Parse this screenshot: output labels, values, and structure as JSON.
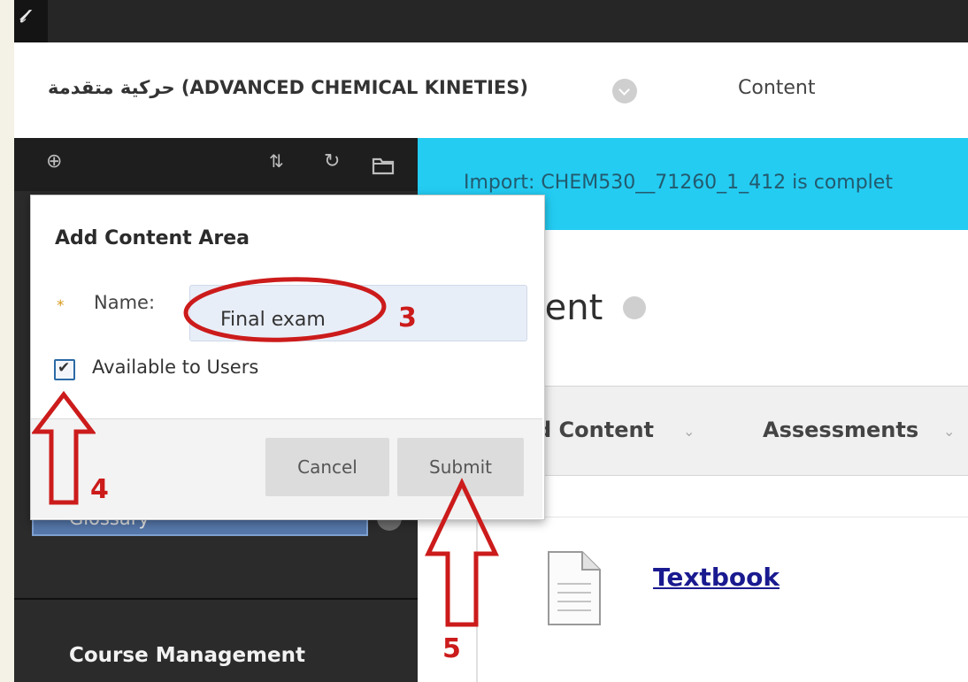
{
  "topbar": {
    "icon": "link-icon"
  },
  "course": {
    "title": "حركية متقدمة (ADVANCED CHEMICAL KINETIES)",
    "breadcrumb": "Content"
  },
  "sidebar": {
    "toolbar_icons": [
      "add-icon",
      "sort-icon",
      "refresh-icon",
      "folder-icon"
    ],
    "glossary_label": "Glossary",
    "course_management": "Course Management"
  },
  "main": {
    "receipt": "Import: CHEM530__71260_1_412 is complet",
    "page_title": "tent",
    "actions": {
      "build_content": "d Content",
      "assessments": "Assessments"
    },
    "items": [
      {
        "title": "Textbook",
        "icon": "document-icon"
      }
    ]
  },
  "dialog": {
    "title": "Add Content Area",
    "required_mark": "*",
    "name_label": "Name:",
    "name_value": "Final exam",
    "available_label": "Available to Users",
    "available_checked": true,
    "cancel_label": "Cancel",
    "submit_label": "Submit"
  },
  "annotations": {
    "step3": "3",
    "step4": "4",
    "step5": "5",
    "color": "#cc1b1b"
  },
  "colors": {
    "receipt_bg": "#24ccf2",
    "sidebar_bg": "#2b2b2b",
    "link": "#1a1a90"
  }
}
